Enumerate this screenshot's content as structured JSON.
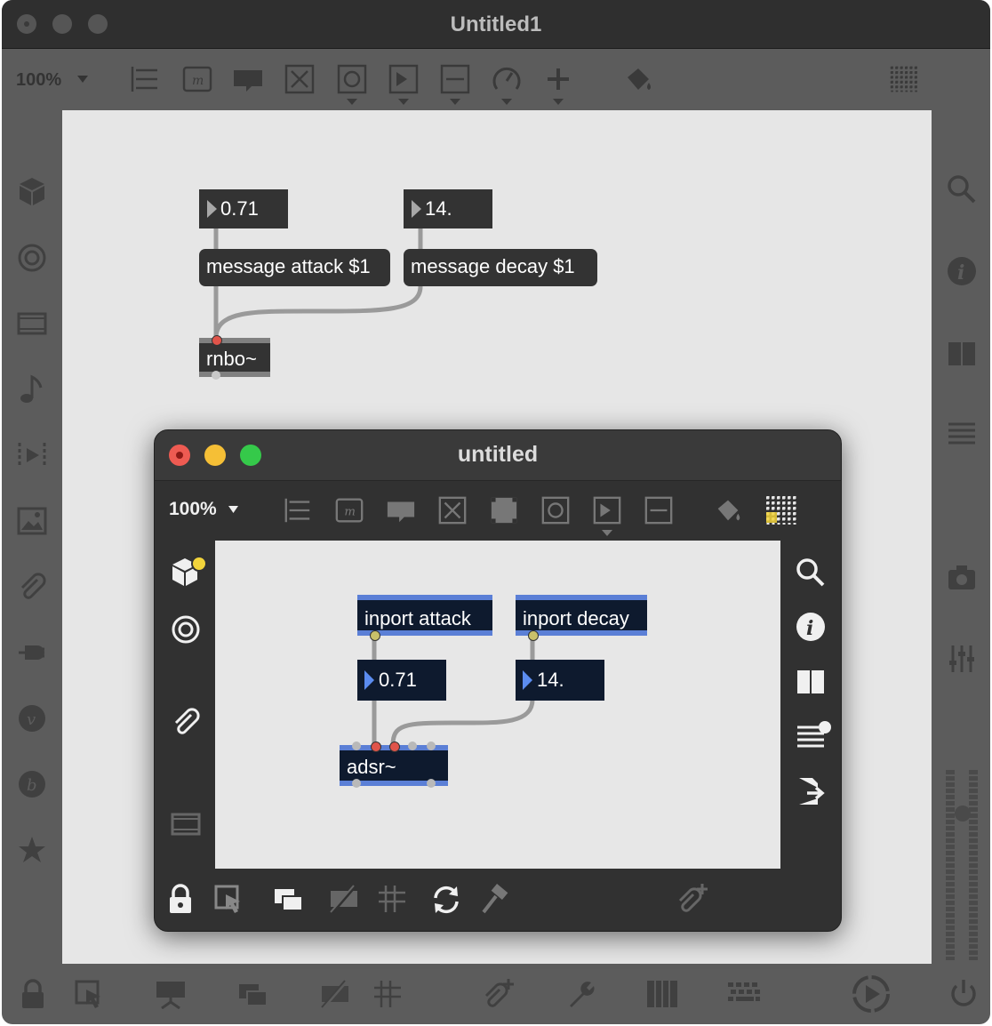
{
  "main_window": {
    "title": "Untitled1",
    "zoom": "100%",
    "objects": {
      "number1": "0.71",
      "number2": "14.",
      "message1": "message attack $1",
      "message2": "message decay $1",
      "rnbo": "rnbo~"
    }
  },
  "sub_window": {
    "title": "untitled",
    "zoom": "100%",
    "objects": {
      "inport1": "inport attack",
      "inport2": "inport decay",
      "number1": "0.71",
      "number2": "14.",
      "adsr": "adsr~"
    }
  },
  "colors": {
    "traffic_red": "#ee5b52",
    "traffic_yellow": "#f5bf36",
    "traffic_green": "#35c94a",
    "rnbo_accent": "#5b7fd6",
    "badge_yellow": "#f2d43b"
  },
  "icons": {
    "main_toolbar": [
      "presentation-icon",
      "message-icon",
      "comment-icon",
      "toggle-icon",
      "button-icon",
      "dial-icon",
      "slider-icon",
      "gauge-icon",
      "plus-icon",
      "paint-bucket-icon",
      "grid-icon"
    ],
    "main_left_sidebar": [
      "cube-icon",
      "target-icon",
      "film-icon",
      "note-icon",
      "snippet-icon",
      "image-icon",
      "paperclip-icon",
      "plug-icon",
      "v-icon",
      "b-icon",
      "star-icon"
    ],
    "main_right_sidebar": [
      "search-icon",
      "info-icon",
      "columns-icon",
      "list-icon",
      "camera-icon",
      "mixer-icon"
    ],
    "main_bottom": [
      "lock-icon",
      "select-icon",
      "presentation-icon",
      "windows-icon",
      "hide-icon",
      "grid-icon",
      "attach-icon",
      "wrench-icon",
      "keys-icon",
      "keyboard-icon",
      "play-icon",
      "power-icon"
    ]
  }
}
